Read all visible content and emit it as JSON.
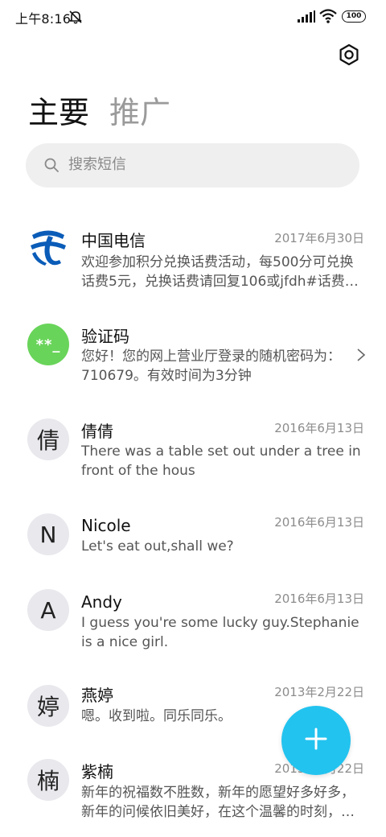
{
  "status_bar": {
    "time": "上午8:16",
    "battery": "100"
  },
  "tabs": {
    "primary": "主要",
    "promo": "推广"
  },
  "search": {
    "placeholder": "搜索短信"
  },
  "messages": [
    {
      "sender": "中国电信",
      "date": "2017年6月30日",
      "preview": "欢迎参加积分兑换话费活动，每500分可兑换话费5元，兑换话费请回复106或jfdh#话费…",
      "avatar_type": "logo",
      "avatar_icon": "china-telecom-logo"
    },
    {
      "sender": "验证码",
      "date": "",
      "preview": "您好！您的网上营业厅登录的随机密码为：710679。有效时间为3分钟",
      "avatar_type": "code",
      "avatar_text": "**_"
    },
    {
      "sender": "倩倩",
      "date": "2016年6月13日",
      "preview": "There was a table set out under a tree in front of the hous",
      "avatar_text": "倩"
    },
    {
      "sender": "Nicole",
      "date": "2016年6月13日",
      "preview": "Let's eat out,shall we?",
      "avatar_text": "N"
    },
    {
      "sender": "Andy",
      "date": "2016年6月13日",
      "preview": "I guess you're some lucky guy.Stephanie is a nice girl.",
      "avatar_text": "A"
    },
    {
      "sender": "燕婷",
      "date": "2013年2月22日",
      "preview": "嗯。收到啦。同乐同乐。",
      "avatar_text": "婷"
    },
    {
      "sender": "紫楠",
      "date": "2013年2月22日",
      "preview": "新年的祝福数不胜数，新年的愿望好多好多，新年的问候依旧美好，在这个温馨的时刻，…",
      "avatar_text": "楠"
    }
  ],
  "colors": {
    "accent": "#22c3ef",
    "code_avatar": "#69d45a",
    "telecom_blue": "#0a5cb8"
  }
}
